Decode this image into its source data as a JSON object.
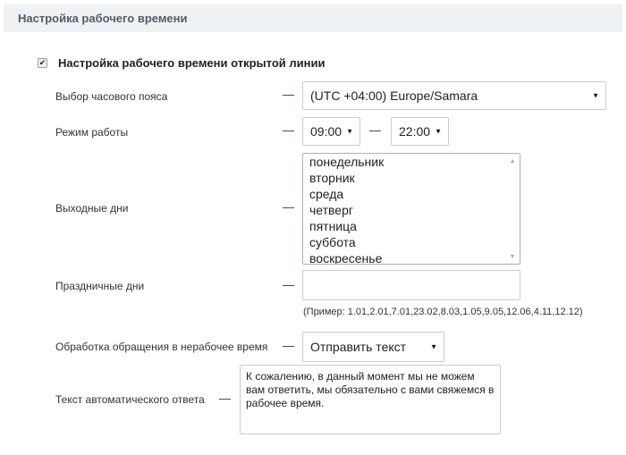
{
  "header": {
    "title": "Настройка рабочего времени"
  },
  "main_checkbox": {
    "checked": true,
    "label": "Настройка рабочего времени открытой линии"
  },
  "dash": "—",
  "timezone": {
    "label": "Выбор часового пояса",
    "value": "(UTC +04:00) Europe/Samara"
  },
  "work_mode": {
    "label": "Режим работы",
    "from": "09:00",
    "to": "22:00"
  },
  "days_off": {
    "label": "Выходные дни",
    "options": [
      "понедельник",
      "вторник",
      "среда",
      "четверг",
      "пятница",
      "суббота",
      "воскресенье"
    ]
  },
  "holidays": {
    "label": "Праздничные дни",
    "value": "",
    "hint": "(Пример: 1.01,2.01,7.01,23.02,8.03,1.05,9.05,12.06,4.11,12.12)"
  },
  "off_hours": {
    "label": "Обработка обращения в нерабочее время",
    "value": "Отправить текст"
  },
  "auto_reply": {
    "label": "Текст автоматического ответа",
    "value": "К сожалению, в данный момент мы не можем вам ответить, мы обязательно с вами свяжемся в рабочее время."
  },
  "icons": {
    "caret": "caret-down-icon",
    "check": "checkmark-icon"
  }
}
